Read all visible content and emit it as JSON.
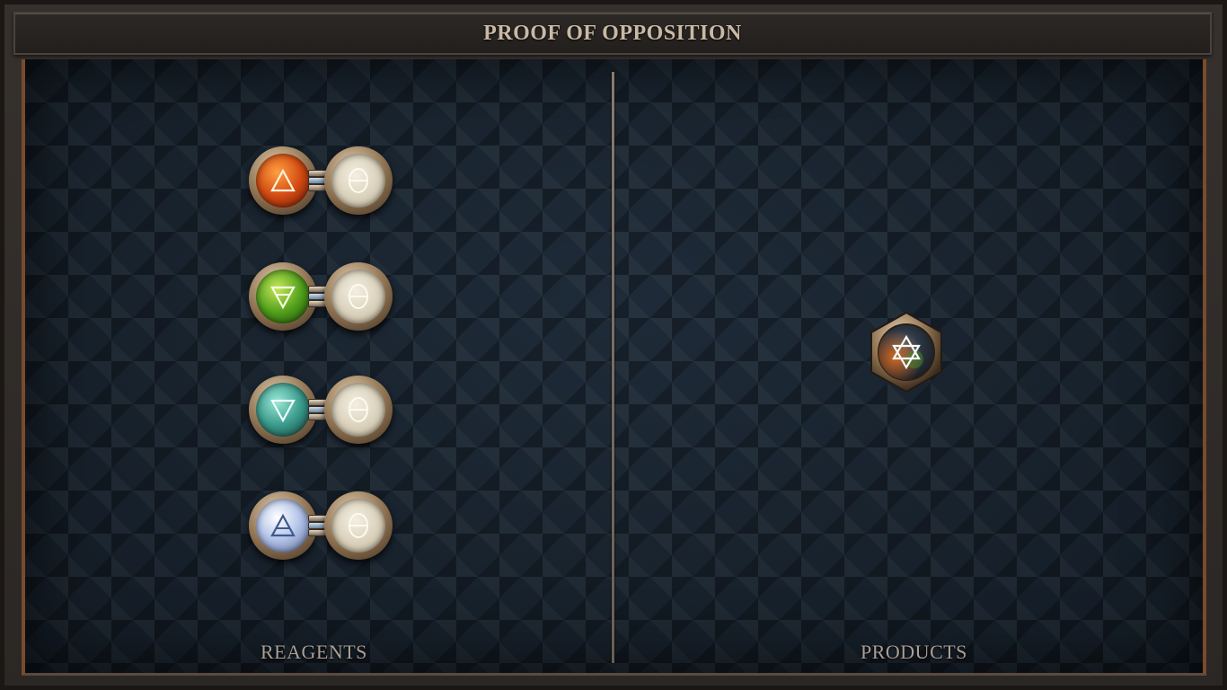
{
  "title": "PROOF OF OPPOSITION",
  "sections": {
    "reagents_label": "REAGENTS",
    "products_label": "PRODUCTS"
  },
  "reagents": [
    {
      "element": "fire",
      "icon": "fire-triangle-icon",
      "color": "#d24a12",
      "paired_with": "theta-icon"
    },
    {
      "element": "earth",
      "icon": "earth-triangle-icon",
      "color": "#52a01c",
      "paired_with": "theta-icon"
    },
    {
      "element": "water",
      "icon": "water-triangle-icon",
      "color": "#3a9a8c",
      "paired_with": "theta-icon"
    },
    {
      "element": "air",
      "icon": "air-triangle-icon",
      "color": "#b6c6ea",
      "paired_with": "theta-icon"
    }
  ],
  "products": [
    {
      "icon": "hexagram-icon",
      "shape": "hexagon"
    }
  ],
  "colors": {
    "frame": "#7a4a2c",
    "board": "#1a2430",
    "text": "#c9b9a4"
  }
}
